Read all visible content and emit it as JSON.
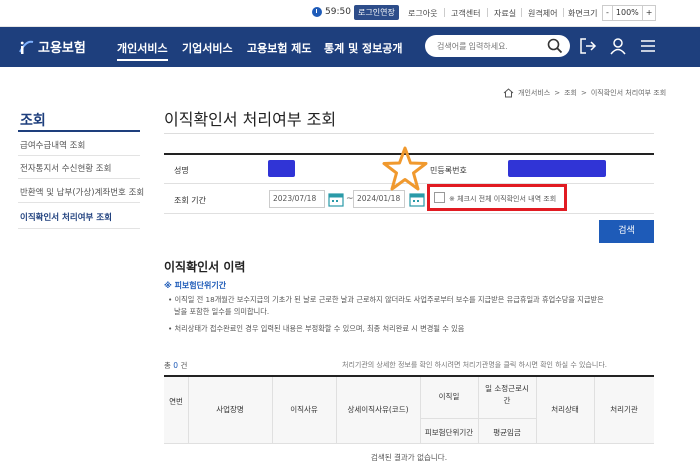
{
  "util": {
    "timer": "59:50",
    "extend_login": "로그인연장",
    "links": [
      "로그아웃",
      "고객센터",
      "자료실",
      "원격제어",
      "화면크기"
    ],
    "zoom_minus": "-",
    "zoom_value": "100%",
    "zoom_plus": "+"
  },
  "header": {
    "logo_text": "고용보험",
    "nav": [
      "개인서비스",
      "기업서비스",
      "고용보험 제도",
      "통계 및 정보공개"
    ],
    "search_placeholder": "검색어를 입력하세요."
  },
  "sidebar": {
    "title": "조회",
    "items": [
      "급여수급내역 조회",
      "전자통지서 수신현황 조회",
      "반환액 및 납부(가상)계좌번호 조회",
      "이직확인서 처리여부 조회"
    ]
  },
  "breadcrumb": [
    "개인서비스",
    "조회",
    "이직확인서 처리여부 조회"
  ],
  "page_title": "이직확인서 처리여부 조회",
  "form": {
    "name_label": "성명",
    "reg_label": "민등록번호",
    "period_label": "조회 기간",
    "date_from": "2023/07/18",
    "date_to": "2024/01/18",
    "tilde": "~",
    "check_label": "※ 체크시 전체 이직확인서 내역 조회",
    "search_button": "검색"
  },
  "history": {
    "title": "이직확인서 이력",
    "sub_head": "※ 피보험단위기간",
    "notes": [
      "• 이직일 전 18개월간 보수지급의 기초가 된 날로 근로한 날과 근로하지 않더라도 사업주로부터 보수를 지급받은 유급휴일과 휴업수당을 지급받은",
      "날을 포함한 일수를 의미합니다.",
      "• 처리상태가 접수완료인 경우 입력된 내용은 부정확할 수 있으며, 최종 처리완료 시 변경될 수 있음"
    ],
    "count_prefix": "총",
    "count_value": "0",
    "count_suffix": "건",
    "table_note": "처리기관의 상세한 정보를 확인 하시려면 처리기관명을 클릭 하시면 확인 하실 수 있습니다.",
    "columns": {
      "no": "연번",
      "company": "사업장명",
      "reason": "이직사유",
      "detail": "상세이직사유(코드)",
      "date": "이직일",
      "insured_period": "피보험단위기간",
      "hours": "일 소정근로시간",
      "avg_wage": "평균임금",
      "status": "처리상태",
      "agency": "처리기관"
    },
    "no_result": "검색된 결과가 없습니다."
  },
  "colors": {
    "header_bg": "#1e3f7d",
    "accent": "#1e5bb8",
    "highlight_box": "#e11b22",
    "star": "#f0992e",
    "redaction": "#3034d6"
  }
}
